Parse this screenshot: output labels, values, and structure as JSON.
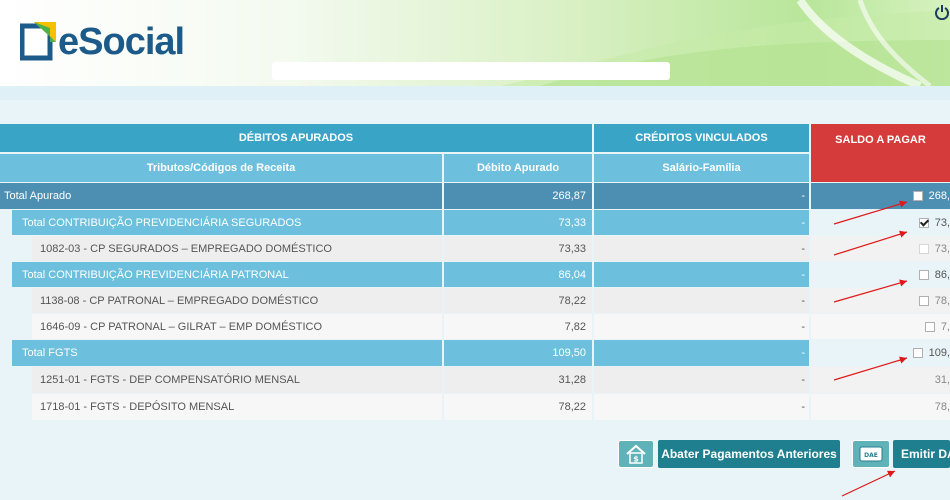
{
  "app": {
    "logo_text": "eSocial"
  },
  "table": {
    "header_debitos": "DÉBITOS APURADOS",
    "header_creditos": "CRÉDITOS VINCULADOS",
    "header_saldo": "SALDO A PAGAR",
    "col_tributos": "Tributos/Códigos de Receita",
    "col_debito": "Débito Apurado",
    "col_salario": "Salário-Família",
    "rows": [
      {
        "label": "Total Apurado",
        "debito": "268,87",
        "credito": "-",
        "saldo": "268,",
        "checked": false
      },
      {
        "label": "Total CONTRIBUIÇÃO PREVIDENCIÁRIA SEGURADOS",
        "debito": "73,33",
        "credito": "-",
        "saldo": "73,",
        "checked": true
      },
      {
        "label": "1082-03 - CP SEGURADOS – EMPREGADO DOMÉSTICO",
        "debito": "73,33",
        "credito": "-",
        "saldo": "73,",
        "checked": false
      },
      {
        "label": "Total CONTRIBUIÇÃO PREVIDENCIÁRIA PATRONAL",
        "debito": "86,04",
        "credito": "-",
        "saldo": "86,",
        "checked": false
      },
      {
        "label": "1138-08 - CP PATRONAL – EMPREGADO DOMÉSTICO",
        "debito": "78,22",
        "credito": "-",
        "saldo": "78,",
        "checked": false
      },
      {
        "label": "1646-09 - CP PATRONAL – GILRAT – EMP DOMÉSTICO",
        "debito": "7,82",
        "credito": "-",
        "saldo": "7,",
        "checked": false
      },
      {
        "label": "Total FGTS",
        "debito": "109,50",
        "credito": "-",
        "saldo": "109,",
        "checked": false
      },
      {
        "label": "1251-01 - FGTS - DEP COMPENSATÓRIO MENSAL",
        "debito": "31,28",
        "credito": "-",
        "saldo": "31,",
        "checked": null
      },
      {
        "label": "1718-01 - FGTS - DEPÓSITO MENSAL",
        "debito": "78,22",
        "credito": "-",
        "saldo": "78,",
        "checked": null
      }
    ]
  },
  "buttons": {
    "abater_label": "Abater Pagamentos Anteriores",
    "emitir_label": "Emitir DA",
    "dae_icon_text": "DAE"
  },
  "colors": {
    "header_blue": "#3aa4c6",
    "light_blue": "#6cc0dd",
    "total_blue": "#4d8fb3",
    "saldo_red": "#d63b3b",
    "button_teal": "#1f7f8f",
    "arrow_red": "#e01818"
  }
}
